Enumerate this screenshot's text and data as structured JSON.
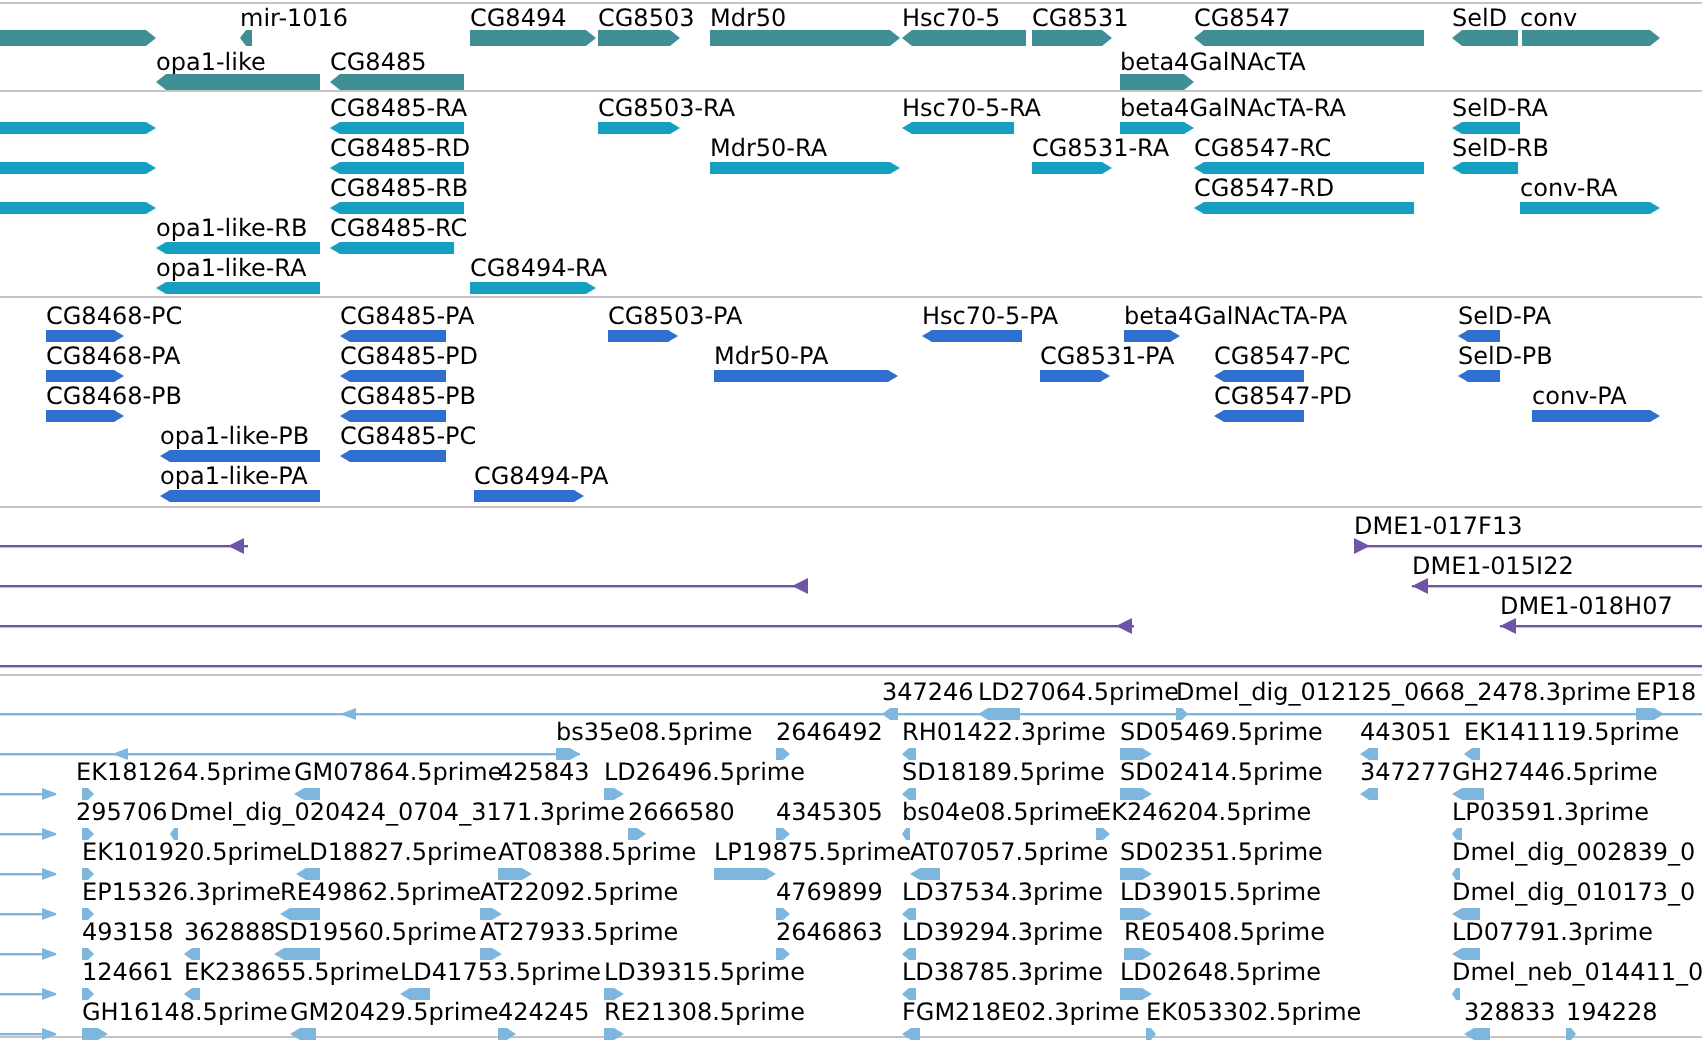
{
  "tracks": [
    {
      "kind": "gene",
      "features": [
        {
          "reverse": false
        },
        {
          "label": "mir-1016",
          "reverse": true
        },
        {
          "label": "CG8494",
          "reverse": false
        },
        {
          "label": "CG8503",
          "reverse": false
        },
        {
          "label": "Mdr50",
          "reverse": false
        },
        {
          "label": "Hsc70-5",
          "reverse": true
        },
        {
          "label": "CG8531",
          "reverse": false
        },
        {
          "label": "CG8547",
          "reverse": true
        },
        {
          "label": "SelD",
          "reverse": true
        },
        {
          "label": "conv",
          "reverse": false
        },
        {
          "label": "opa1-like",
          "reverse": true
        },
        {
          "label": "CG8485",
          "reverse": true
        },
        {
          "label": "beta4GalNAcTA",
          "reverse": false
        }
      ]
    },
    {
      "kind": "transcript",
      "features": [
        {
          "reverse": false
        },
        {
          "reverse": false
        },
        {
          "reverse": false
        },
        {
          "label": "CG8485-RA",
          "reverse": true
        },
        {
          "label": "CG8485-RD",
          "reverse": true
        },
        {
          "label": "CG8485-RB",
          "reverse": true
        },
        {
          "label": "CG8485-RC",
          "reverse": true
        },
        {
          "label": "opa1-like-RB",
          "reverse": true
        },
        {
          "label": "opa1-like-RA",
          "reverse": true
        },
        {
          "label": "CG8494-RA",
          "reverse": false
        },
        {
          "label": "CG8503-RA",
          "reverse": false
        },
        {
          "label": "Mdr50-RA",
          "reverse": false
        },
        {
          "label": "Hsc70-5-RA",
          "reverse": true
        },
        {
          "label": "CG8531-RA",
          "reverse": false
        },
        {
          "label": "beta4GalNAcTA-RA",
          "reverse": false
        },
        {
          "label": "CG8547-RC",
          "reverse": true
        },
        {
          "label": "CG8547-RD",
          "reverse": true
        },
        {
          "label": "SelD-RA",
          "reverse": true
        },
        {
          "label": "SelD-RB",
          "reverse": true
        },
        {
          "label": "conv-RA",
          "reverse": false
        }
      ]
    },
    {
      "kind": "protein",
      "features": [
        {
          "label": "CG8468-PC",
          "reverse": false
        },
        {
          "label": "CG8468-PA",
          "reverse": false
        },
        {
          "label": "CG8468-PB",
          "reverse": false
        },
        {
          "label": "opa1-like-PB",
          "reverse": true
        },
        {
          "label": "opa1-like-PA",
          "reverse": true
        },
        {
          "label": "CG8485-PA",
          "reverse": true
        },
        {
          "label": "CG8485-PD",
          "reverse": true
        },
        {
          "label": "CG8485-PB",
          "reverse": true
        },
        {
          "label": "CG8485-PC",
          "reverse": true
        },
        {
          "label": "CG8494-PA",
          "reverse": false
        },
        {
          "label": "CG8503-PA",
          "reverse": false
        },
        {
          "label": "Mdr50-PA",
          "reverse": false
        },
        {
          "label": "Hsc70-5-PA",
          "reverse": true
        },
        {
          "label": "CG8531-PA",
          "reverse": false
        },
        {
          "label": "beta4GalNAcTA-PA",
          "reverse": false
        },
        {
          "label": "CG8547-PC",
          "reverse": true
        },
        {
          "label": "CG8547-PD",
          "reverse": true
        },
        {
          "label": "SelD-PA",
          "reverse": true
        },
        {
          "label": "SelD-PB",
          "reverse": true
        },
        {
          "label": "conv-PA",
          "reverse": false
        }
      ]
    },
    {
      "kind": "clone",
      "features": [
        {
          "reverse": true,
          "arrowhead": true
        },
        {
          "reverse": true,
          "arrowhead": true
        },
        {
          "reverse": true,
          "arrowhead": true
        },
        {
          "arrowhead": false
        },
        {
          "label": "DME1-017F13",
          "reverse": false,
          "arrowhead": true
        },
        {
          "label": "DME1-015I22",
          "reverse": true,
          "arrowhead": true
        },
        {
          "label": "DME1-018H07",
          "reverse": true,
          "arrowhead": true
        }
      ]
    },
    {
      "kind": "est",
      "features": [
        {
          "reverse": true
        },
        {
          "label": "347246",
          "reverse": true
        },
        {
          "label": "LD27064.5prime",
          "reverse": true
        },
        {
          "label": "Dmel_dig_012125_0668_2478.3prime",
          "reverse": false
        },
        {
          "label": "EP18",
          "reverse": false
        },
        {
          "reverse": true
        },
        {
          "label": "bs35e08.5prime",
          "reverse": false
        },
        {
          "label": "2646492",
          "reverse": false
        },
        {
          "label": "RH01422.3prime",
          "reverse": true
        },
        {
          "label": "SD05469.5prime",
          "reverse": false
        },
        {
          "label": "443051",
          "reverse": true
        },
        {
          "label": "EK141119.5prime",
          "reverse": true
        },
        {
          "reverse": false
        },
        {
          "label": "EK181264.5prime",
          "reverse": false
        },
        {
          "label": "GM07864.5prime",
          "reverse": true
        },
        {
          "label": "425843"
        },
        {
          "label": "LD26496.5prime",
          "reverse": false
        },
        {
          "label": "SD18189.5prime",
          "reverse": true
        },
        {
          "label": "SD02414.5prime",
          "reverse": false
        },
        {
          "label": "347277",
          "reverse": true
        },
        {
          "label": "GH27446.5prime",
          "reverse": true
        },
        {
          "reverse": false
        },
        {
          "label": "295706",
          "reverse": false
        },
        {
          "label": "Dmel_dig_020424_0704_3171.3prime",
          "reverse": true
        },
        {
          "label": "2666580",
          "reverse": false
        },
        {
          "label": "4345305",
          "reverse": false
        },
        {
          "label": "bs04e08.5prime",
          "reverse": true
        },
        {
          "label": "EK246204.5prime",
          "reverse": false
        },
        {
          "label": "LP03591.3prime",
          "reverse": true
        },
        {
          "reverse": false
        },
        {
          "label": "EK101920.5prime",
          "reverse": false
        },
        {
          "label": "LD18827.5prime",
          "reverse": true
        },
        {
          "label": "AT08388.5prime",
          "reverse": false
        },
        {
          "label": "LP19875.5prime",
          "reverse": false
        },
        {
          "label": "AT07057.5prime",
          "reverse": true
        },
        {
          "label": "SD02351.5prime",
          "reverse": false
        },
        {
          "label": "Dmel_dig_002839_0",
          "reverse": true
        },
        {
          "reverse": false
        },
        {
          "label": "EP15326.3prime",
          "reverse": false
        },
        {
          "label": "RE49862.5prime",
          "reverse": true
        },
        {
          "label": "AT22092.5prime",
          "reverse": false
        },
        {
          "label": "4769899",
          "reverse": false
        },
        {
          "label": "LD37534.3prime",
          "reverse": true
        },
        {
          "label": "LD39015.5prime",
          "reverse": false
        },
        {
          "label": "Dmel_dig_010173_0",
          "reverse": true
        },
        {
          "reverse": false
        },
        {
          "label": "493158",
          "reverse": false
        },
        {
          "label": "362888",
          "reverse": true
        },
        {
          "label": "SD19560.5prime",
          "reverse": true
        },
        {
          "label": "AT27933.5prime",
          "reverse": false
        },
        {
          "label": "2646863",
          "reverse": false
        },
        {
          "label": "LD39294.3prime",
          "reverse": true
        },
        {
          "label": "RE05408.5prime",
          "reverse": false
        },
        {
          "label": "LD07791.3prime",
          "reverse": true
        },
        {
          "reverse": false
        },
        {
          "label": "124661",
          "reverse": false
        },
        {
          "label": "EK238655.5prime",
          "reverse": true
        },
        {
          "label": "LD41753.5prime",
          "reverse": true
        },
        {
          "label": "LD39315.5prime",
          "reverse": false
        },
        {
          "label": "LD38785.3prime",
          "reverse": true
        },
        {
          "label": "LD02648.5prime",
          "reverse": false
        },
        {
          "label": "Dmel_neb_014411_0",
          "reverse": true
        },
        {
          "reverse": false
        },
        {
          "label": "GH16148.5prime",
          "reverse": false
        },
        {
          "label": "GM20429.5prime",
          "reverse": true
        },
        {
          "label": "424245",
          "reverse": false
        },
        {
          "label": "RE21308.5prime",
          "reverse": false
        },
        {
          "label": "FGM218E02.3prime",
          "reverse": true
        },
        {
          "label": "EK053302.5prime",
          "reverse": false
        },
        {
          "label": "328833",
          "reverse": true
        },
        {
          "label": "194228",
          "reverse": false
        }
      ]
    }
  ]
}
